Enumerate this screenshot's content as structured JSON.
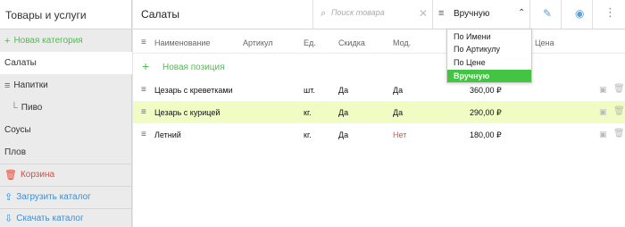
{
  "sidebar": {
    "title": "Товары и услуги",
    "new_category": "Новая категория",
    "categories": [
      "Салаты",
      "Напитки",
      "Пиво",
      "Соусы",
      "Плов"
    ],
    "cart": "Корзина",
    "upload": "Загрузить каталог",
    "download": "Скачать каталог"
  },
  "topbar": {
    "title": "Салаты",
    "search_placeholder": "Поиск товара",
    "sort_label": "Вручную"
  },
  "sort_options": [
    "По Имени",
    "По Артикулу",
    "По Цене",
    "Вручную"
  ],
  "sort_selected": "Вручную",
  "table": {
    "headers": [
      "Наименование",
      "Артикул",
      "Ед.",
      "Скидка",
      "Мод.",
      "Цена"
    ],
    "new_position": "Новая позиция",
    "rows": [
      {
        "name": "Цезарь с креветками",
        "unit": "шт.",
        "discount": "Да",
        "mod": "Да",
        "price": "360,00 ₽",
        "selected": false
      },
      {
        "name": "Цезарь с курицей",
        "unit": "кг.",
        "discount": "Да",
        "mod": "Да",
        "price": "290,00 ₽",
        "selected": true
      },
      {
        "name": "Летний",
        "unit": "кг.",
        "discount": "Да",
        "mod": "Нет",
        "price": "180,00 ₽",
        "selected": false
      }
    ]
  },
  "colors": {
    "accent_green": "#4cc04c",
    "selected_row": "#f1fcc4",
    "danger_red": "#e24a3b",
    "link_blue": "#3a8fd6"
  }
}
